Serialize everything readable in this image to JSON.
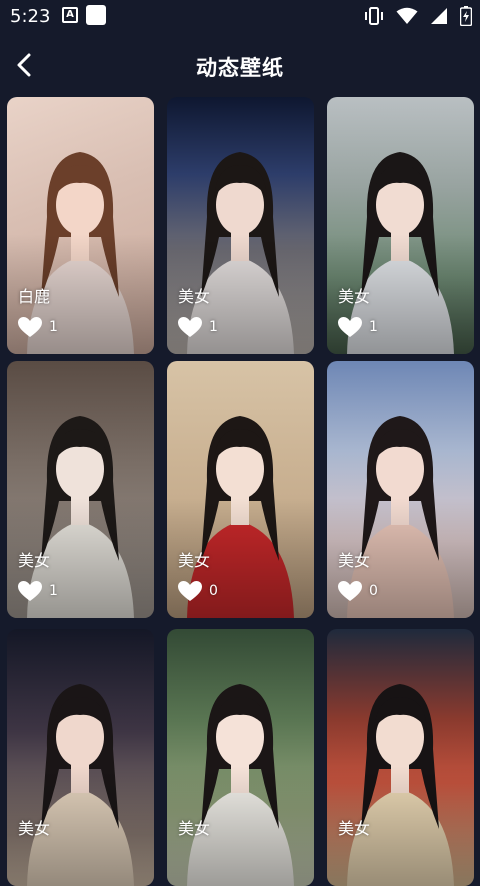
{
  "status_bar": {
    "time": "5:23",
    "left_icons": [
      "keyboard-a-icon",
      "notification-square-icon"
    ],
    "right_icons": [
      "vibrate-icon",
      "wifi-icon",
      "cellular-icon",
      "battery-icon"
    ]
  },
  "header": {
    "back_icon": "chevron-left-icon",
    "title": "动态壁纸"
  },
  "colors": {
    "background": "#151a2b",
    "text": "#ffffff"
  },
  "wallpapers": [
    {
      "label": "白鹿",
      "likes": "1",
      "bg": "linear-gradient(160deg,#e9d3c8 0%,#d9bfb3 40%,#c9a89a 100%)",
      "hair": "#6b3f2a",
      "skin": "#f3d6c8",
      "cloth": "#e8d8d3"
    },
    {
      "label": "美女",
      "likes": "1",
      "bg": "linear-gradient(180deg,#0e1730 0%,#2d3d6a 30%,#6b6a72 60%,#b9b2ac 100%)",
      "hair": "#1c1715",
      "skin": "#efd9cf",
      "cloth": "#e3dedd"
    },
    {
      "label": "美女",
      "likes": "1",
      "bg": "linear-gradient(180deg,#b9bfc2 0%,#98a3a0 35%,#6e8a74 70%,#445b48 100%)",
      "hair": "#1a1616",
      "skin": "#f1dcd2",
      "cloth": "#dfe2e6"
    },
    {
      "label": "美女",
      "likes": "1",
      "bg": "linear-gradient(180deg,#5a4c44 0%,#7a6e66 40%,#9d958e 100%)",
      "hair": "#1d1917",
      "skin": "#efe2da",
      "cloth": "#e6e3dc"
    },
    {
      "label": "美女",
      "likes": "0",
      "bg": "linear-gradient(180deg,#d7c3a6 0%,#cbb394 40%,#b99d7e 100%)",
      "hair": "#1d1715",
      "skin": "#f3dfd3",
      "cloth": "#c8282a"
    },
    {
      "label": "美女",
      "likes": "0",
      "bg": "linear-gradient(180deg,#6e87b5 0%,#a8b6cf 35%,#d9c7c9 70%,#cfb9b2 100%)",
      "hair": "#1f1819",
      "skin": "#f2dad0",
      "cloth": "#e8c5b8"
    },
    {
      "label": "美女",
      "likes": "",
      "bg": "linear-gradient(180deg,#141726 0%,#3e3544 40%,#8a7a72 80%,#c9b6a2 100%)",
      "hair": "#1a1516",
      "skin": "#efd7cc",
      "cloth": "#e3d2bd"
    },
    {
      "label": "美女",
      "likes": "",
      "bg": "linear-gradient(180deg,#334a35 0%,#597552 35%,#8fa079 70%,#c7ccb6 100%)",
      "hair": "#1b1616",
      "skin": "#f5e2d8",
      "cloth": "#f1efe9"
    },
    {
      "label": "美女",
      "likes": "",
      "bg": "linear-gradient(180deg,#1f2a3c 0%,#8a3a2e 35%,#c1523d 60%,#d0b58e 100%)",
      "hair": "#171314",
      "skin": "#f2dcd0",
      "cloth": "#ead7b4"
    }
  ]
}
